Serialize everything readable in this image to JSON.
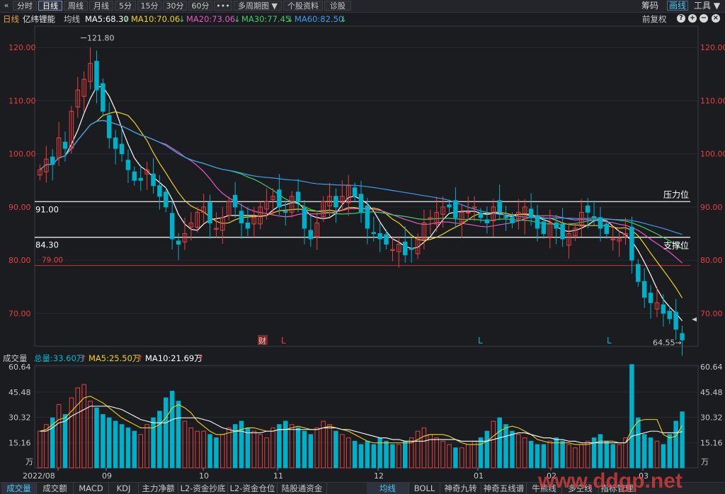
{
  "toolbar": {
    "back_icon": "«",
    "tabs": [
      "分时",
      "日线",
      "周线",
      "月线",
      "5分",
      "15分",
      "30分",
      "60分",
      "•••",
      "多周期图 ▼",
      "个股资料",
      "诊股"
    ],
    "active_tab": "日线",
    "right": [
      "筹码",
      "画线",
      "工具 ▼"
    ],
    "right_active": "画线"
  },
  "info": {
    "period": "日线",
    "stock_name": "亿纬锂能",
    "avg_line_label": "均线",
    "ma5": "MA5:68.30",
    "ma10": "MA10:70.06",
    "ma20": "MA20:73.06",
    "ma30": "MA30:77.45",
    "ma60": "MA60:82.50",
    "arrow_down": "↓",
    "adjust": "前复权",
    "colors": {
      "ma5": "#ffffff",
      "ma10": "#f2d21b",
      "ma20": "#e858c8",
      "ma30": "#3fcf5f",
      "ma60": "#3c9cf0",
      "up": "#e84040",
      "down": "#00b0c8",
      "text": "#c8c8c8"
    }
  },
  "price_axis": {
    "ticks": [
      "120.00",
      "110.00",
      "100.00",
      "90.00",
      "80.00",
      "70.00"
    ],
    "range": [
      63.8,
      124.0
    ]
  },
  "annotations": {
    "high_label": "121.80",
    "low_label": "64.55",
    "pressure_value": "91.00",
    "pressure_label": "压力位",
    "support_value": "84.30",
    "support_label": "支撑位",
    "red_line_value": "79.00",
    "markers": [
      "财",
      "L",
      "L",
      "L"
    ]
  },
  "volume_info": {
    "title": "成交量",
    "total": "总量:33.60万",
    "ma5": "MA5:25.50万",
    "ma10": "MA10:21.69万",
    "up_arrow": "↑"
  },
  "volume_axis": {
    "ticks": [
      "60.64",
      "45.48",
      "30.32",
      "15.16"
    ],
    "unit": "万",
    "max": 60.64
  },
  "date_axis": {
    "labels": [
      "2022/08",
      "09",
      "10",
      "11",
      "12",
      "01",
      "02",
      "03"
    ]
  },
  "bottom_tabs": [
    "成交量",
    "成交额",
    "MACD",
    "KDJ",
    "主力净额",
    "L2-资金抄底",
    "L2-资金仓位",
    "陆股通资金",
    "均线",
    "BOLL",
    "神奇九转",
    "神奇五线谱",
    "牛熊线",
    "多空线",
    "指标管理"
  ],
  "bottom_active": "成交量",
  "bottom_active2": "均线",
  "watermark": "www.ddgp.net",
  "chart_data": {
    "type": "candlestick",
    "price_range": [
      63.8,
      124.0
    ],
    "reference_lines": [
      {
        "name": "压力位",
        "value": 91.0
      },
      {
        "name": "支撑位",
        "value": 84.3
      },
      {
        "name": "",
        "value": 79.0
      }
    ],
    "close": [
      97,
      99,
      98,
      103,
      101,
      108,
      112,
      114,
      117,
      112,
      108,
      103,
      101,
      100,
      97,
      95,
      95,
      97,
      94,
      92,
      90,
      84,
      83,
      85,
      87,
      89,
      90,
      87,
      86,
      88,
      91,
      90,
      87,
      86,
      88,
      90,
      91,
      92,
      90,
      89,
      92,
      91,
      86,
      84,
      87,
      91,
      92,
      90,
      92,
      94,
      92,
      89,
      86,
      85,
      84,
      83,
      82,
      83,
      81,
      82,
      84,
      87,
      88,
      89,
      90,
      90,
      88,
      89,
      89,
      90,
      88,
      87,
      90,
      89,
      88,
      87,
      89,
      90,
      88,
      86,
      85,
      87,
      86,
      84,
      85,
      86,
      89,
      89,
      88,
      86,
      85,
      84,
      84,
      85,
      80,
      76,
      73,
      72,
      72,
      70,
      69,
      67,
      65
    ],
    "volume_wan": [
      22,
      26,
      30,
      38,
      32,
      42,
      48,
      50,
      40,
      36,
      32,
      30,
      28,
      26,
      24,
      22,
      20,
      26,
      30,
      34,
      42,
      46,
      40,
      28,
      24,
      22,
      22,
      20,
      18,
      20,
      24,
      26,
      28,
      24,
      22,
      20,
      18,
      24,
      26,
      28,
      26,
      24,
      22,
      20,
      24,
      28,
      26,
      22,
      20,
      18,
      16,
      14,
      16,
      14,
      18,
      16,
      14,
      14,
      16,
      18,
      22,
      24,
      20,
      18,
      16,
      14,
      12,
      12,
      14,
      16,
      18,
      22,
      28,
      30,
      26,
      22,
      20,
      18,
      16,
      14,
      14,
      16,
      18,
      16,
      14,
      12,
      14,
      16,
      18,
      20,
      16,
      14,
      14,
      18,
      62,
      30,
      20,
      18,
      16,
      14,
      20,
      28,
      33.6
    ],
    "ma5_volume": [
      22,
      23,
      26,
      29,
      30,
      34,
      38,
      42,
      43,
      41,
      39,
      36,
      33,
      30,
      28,
      26,
      24,
      24,
      24,
      26,
      30,
      36,
      38,
      36,
      33,
      28,
      25,
      22,
      20,
      20,
      21,
      22,
      23,
      24,
      24,
      23,
      22,
      22,
      23,
      23,
      24,
      25,
      24,
      23,
      23,
      24,
      25,
      24,
      23,
      22,
      20,
      18,
      16,
      15,
      15,
      15,
      15,
      15,
      15,
      15,
      17,
      19,
      20,
      20,
      20,
      19,
      17,
      15,
      14,
      14,
      14,
      16,
      19,
      22,
      24,
      25,
      24,
      22,
      20,
      17,
      16,
      15,
      15,
      15,
      15,
      14,
      14,
      14,
      15,
      16,
      16,
      16,
      15,
      15,
      23,
      28,
      29,
      29,
      29,
      20,
      18,
      19,
      25.5
    ],
    "ma10_volume": [
      22,
      22,
      24,
      27,
      28,
      31,
      33,
      35,
      37,
      37,
      37,
      37,
      36,
      35,
      33,
      31,
      29,
      28,
      27,
      27,
      27,
      29,
      30,
      30,
      30,
      30,
      29,
      28,
      26,
      24,
      23,
      22,
      22,
      21,
      21,
      21,
      22,
      22,
      23,
      23,
      23,
      23,
      23,
      23,
      23,
      24,
      24,
      24,
      23,
      23,
      22,
      21,
      20,
      19,
      18,
      18,
      17,
      17,
      16,
      16,
      16,
      16,
      17,
      17,
      17,
      17,
      17,
      16,
      16,
      16,
      16,
      16,
      17,
      18,
      19,
      20,
      21,
      21,
      20,
      19,
      18,
      18,
      17,
      17,
      16,
      16,
      15,
      15,
      15,
      15,
      15,
      15,
      15,
      15,
      19,
      20,
      21,
      22,
      22,
      21,
      21,
      21,
      21.69
    ],
    "x_ticks": [
      "2022/08",
      "09",
      "10",
      "11",
      "12",
      "01",
      "02",
      "03"
    ],
    "ma_last": {
      "MA5": 68.3,
      "MA10": 70.06,
      "MA20": 73.06,
      "MA30": 77.45,
      "MA60": 82.5
    }
  }
}
